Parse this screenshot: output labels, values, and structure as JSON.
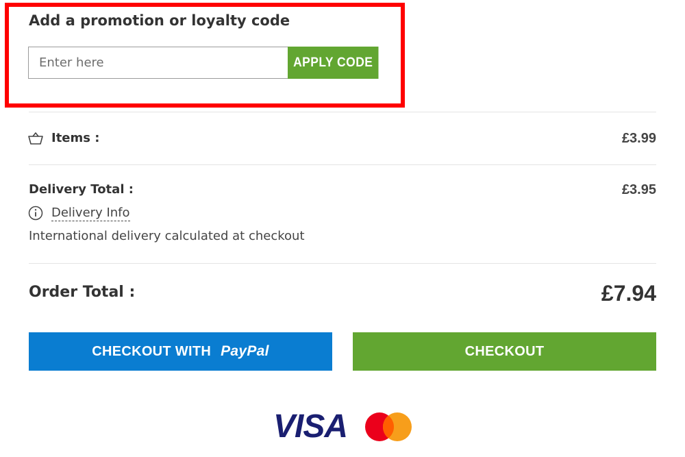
{
  "promo": {
    "title": "Add a promotion or loyalty code",
    "input_placeholder": "Enter here",
    "input_value": "",
    "apply_label": "APPLY CODE",
    "highlight_color": "#ff0000"
  },
  "summary": {
    "items_label": "Items :",
    "items_amount": "£3.99",
    "delivery_label": "Delivery Total :",
    "delivery_amount": "£3.95",
    "delivery_info_label": "Delivery Info",
    "delivery_note": "International delivery calculated at checkout",
    "order_total_label": "Order Total :",
    "order_total_amount": "£7.94"
  },
  "buttons": {
    "paypal_prefix": "CHECKOUT WITH",
    "paypal_brand": "PayPal",
    "checkout_label": "CHECKOUT"
  },
  "payment_logos": {
    "visa_text": "VISA",
    "mastercard": "mastercard-logo"
  },
  "colors": {
    "accent_green": "#62a631",
    "paypal_blue": "#0a7dd1",
    "visa_navy": "#1a1f71"
  }
}
